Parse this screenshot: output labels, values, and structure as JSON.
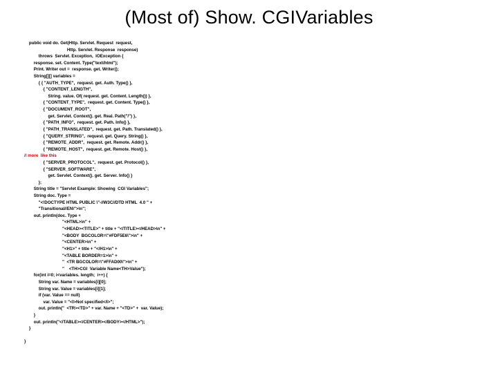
{
  "title": "(Most of) Show. CGIVariables",
  "code_lines": [
    {
      "indent": 1,
      "text": "public void do. Get(Http. Servlet. Request  request,"
    },
    {
      "indent": 9,
      "text": "Http. Servlet. Response  response)"
    },
    {
      "indent": 3,
      "text": "throws  Servlet. Exception,  IOException {"
    },
    {
      "indent": 2,
      "text": "response. set. Content. Type(\"text/html\");"
    },
    {
      "indent": 2,
      "text": "Print. Writer out =  response. get. Writer();"
    },
    {
      "indent": 2,
      "text": "String[][] variables ="
    },
    {
      "indent": 3,
      "text": "{ { \"AUTH_TYPE\",  request. get. Auth. Type() },"
    },
    {
      "indent": 4,
      "text": "{ \"CONTENT_LENGTH\","
    },
    {
      "indent": 5,
      "text": "String. value. Of( request. get. Content. Length()) },"
    },
    {
      "indent": 4,
      "text": "{ \"CONTENT_TYPE\",  request. get. Content. Type() },"
    },
    {
      "indent": 4,
      "text": "{ \"DOCUMENT_ROOT\","
    },
    {
      "indent": 5,
      "text": "get. Servlet. Context(). get. Real. Path(\"/\") },"
    },
    {
      "indent": 4,
      "text": "{ \"PATH_INFO\",  request. get. Path. Info() },"
    },
    {
      "indent": 4,
      "text": "{ \"PATH_TRANSLATED\",  request. get. Path. Translated() },"
    },
    {
      "indent": 4,
      "text": "{ \"QUERY_STRING\",  request. get. Query. String() },"
    },
    {
      "indent": 4,
      "text": "{ \"REMOTE_ADDR\",  request. get. Remote. Addr() },"
    },
    {
      "indent": 4,
      "text": "{ \"REMOTE_HOST\",  request. get. Remote. Host() },"
    },
    {
      "indent": 0,
      "text": "// more  like this",
      "red": true
    },
    {
      "indent": 4,
      "text": "{ \"SERVER_PROTOCOL\",  request. get. Protocol() },"
    },
    {
      "indent": 4,
      "text": "{ \"SERVER_SOFTWARE\","
    },
    {
      "indent": 5,
      "text": "get. Servlet. Context(). get. Server. Info() }"
    },
    {
      "indent": 3,
      "text": "};"
    },
    {
      "indent": 2,
      "text": "String title = \"Servlet Example: Showing  CGI Variables\";"
    },
    {
      "indent": 2,
      "text": "String doc. Type ="
    },
    {
      "indent": 3,
      "text": "\"<!DOCTYPE HTML PUBLIC \\\"-//W3C//DTD HTML  4.0 \" +"
    },
    {
      "indent": 3,
      "text": "\"Transitional//EN\\\">\\n\";"
    },
    {
      "indent": 2,
      "text": "out. println(doc. Type +"
    },
    {
      "indent": 8,
      "text": "\"<HTML>\\n\" +"
    },
    {
      "indent": 8,
      "text": "\"<HEAD><TITLE>\" + title + \"</TITLE></HEAD>\\n\" +"
    },
    {
      "indent": 8,
      "text": "\"<BODY  BGCOLOR=\\\"#FDF5E6\\\">\\n\" +"
    },
    {
      "indent": 8,
      "text": "\"<CENTER>\\n\" +"
    },
    {
      "indent": 8,
      "text": "\"<H1>\" + title + \"</H1>\\n\" +"
    },
    {
      "indent": 8,
      "text": "\"<TABLE BORDER=1>\\n\" +"
    },
    {
      "indent": 8,
      "text": "\"  <TR BGCOLOR=\\\"#FFAD00\\\">\\n\" +"
    },
    {
      "indent": 8,
      "text": "\"    <TH>CGI  Variable Name<TH>Value\");"
    },
    {
      "indent": 2,
      "text": "for(int i=0; i<variables. length;  i++) {"
    },
    {
      "indent": 3,
      "text": "String var. Name = variables[i][0];"
    },
    {
      "indent": 3,
      "text": "String var. Value = variables[i][1];"
    },
    {
      "indent": 3,
      "text": "if (var. Value == null)"
    },
    {
      "indent": 4,
      "text": "var. Value = \"<I>Not specified</I>\";"
    },
    {
      "indent": 3,
      "text": "out. println(\"  <TR><TD>\" + var. Name + \"<TD>\" +  var. Value);"
    },
    {
      "indent": 2,
      "text": "}"
    },
    {
      "indent": 2,
      "text": "out. println(\"</TABLE></CENTER></BODY></HTML>\");"
    },
    {
      "indent": 1,
      "text": "}"
    },
    {
      "indent": 0,
      "text": ""
    },
    {
      "indent": 0,
      "text": "}"
    }
  ]
}
